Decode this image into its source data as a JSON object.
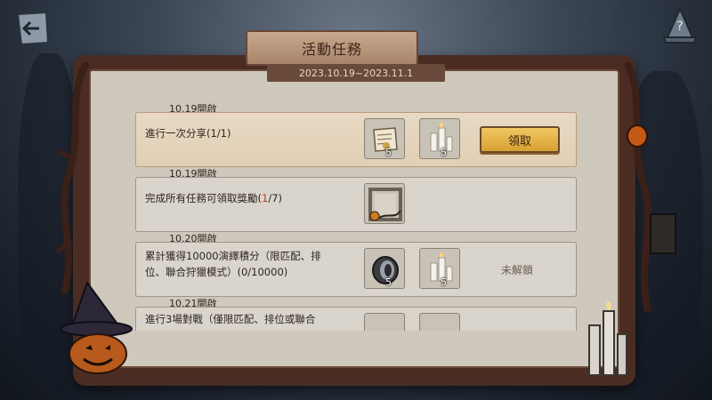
{
  "title": "活動任務",
  "date_range": "2023.10.19~2023.11.1",
  "tasks": [
    {
      "date": "10.19開啟",
      "desc": "進行一次分享(1/1)",
      "rewards": [
        {
          "icon": "letter-icon",
          "count": "5"
        },
        {
          "icon": "candles-icon",
          "count": "5"
        }
      ],
      "action": "領取",
      "state": "claimable"
    },
    {
      "date": "10.19開啟",
      "desc_prefix": "完成所有任務可領取獎勵(",
      "desc_highlight": "1",
      "desc_suffix": "/7)",
      "rewards": [
        {
          "icon": "portrait-frame-icon",
          "count": ""
        }
      ],
      "state": "in-progress"
    },
    {
      "date": "10.20開啟",
      "desc": "累計獲得10000演繹積分（限匹配、排位、聯合狩獵模式）(0/10000)",
      "rewards": [
        {
          "icon": "ring-icon",
          "count": "5"
        },
        {
          "icon": "candles-icon",
          "count": "5"
        }
      ],
      "action": "未解鎖",
      "state": "locked"
    },
    {
      "date": "10.21開啟",
      "desc": "進行3場對戰（僅限匹配、排位或聯合",
      "state": "locked"
    }
  ],
  "colors": {
    "claim_button": "#e6b44a",
    "highlight": "#c0392b",
    "board_frame": "#4a2c22",
    "paper": "#cfc8bd"
  }
}
